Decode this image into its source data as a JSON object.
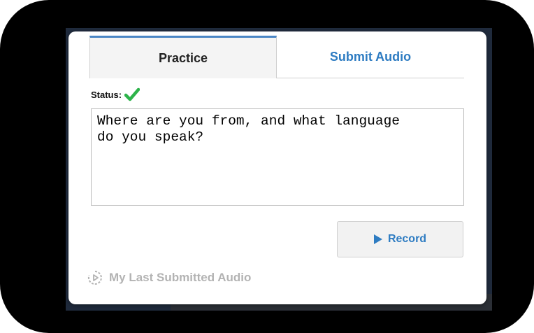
{
  "tabs": [
    {
      "label": "Practice",
      "active": true
    },
    {
      "label": "Submit Audio",
      "active": false
    }
  ],
  "status": {
    "label": "Status:",
    "icon": "check-icon",
    "color": "#2db34a"
  },
  "prompt_text": "Where are you from, and what language\ndo you speak?",
  "record_button": {
    "label": "Record",
    "icon": "play-icon"
  },
  "last_audio": {
    "label": "My Last Submitted Audio",
    "icon": "replay-icon"
  },
  "colors": {
    "accent": "#2e7cc2",
    "tab_border": "#4a86c5",
    "muted": "#b3b3b3"
  }
}
